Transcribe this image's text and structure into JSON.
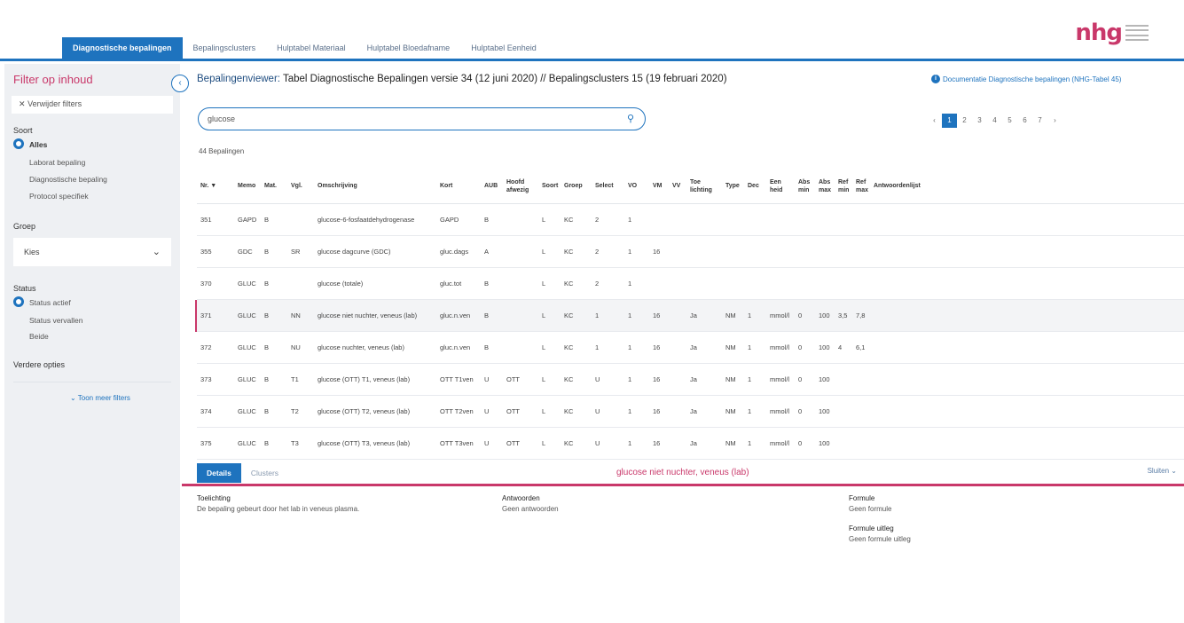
{
  "logo": {
    "text": "nhg"
  },
  "tabs": [
    {
      "label": "Diagnostische bepalingen"
    },
    {
      "label": "Bepalingsclusters"
    },
    {
      "label": "Hulptabel Materiaal"
    },
    {
      "label": "Hulptabel Bloedafname"
    },
    {
      "label": "Hulptabel Eenheid"
    }
  ],
  "sidebar": {
    "title": "Filter op inhoud",
    "clear_filters": "Verwijder filters",
    "soort_label": "Soort",
    "soort_options": [
      "Alles",
      "Laborat bepaling",
      "Diagnostische bepaling",
      "Protocol specifiek"
    ],
    "groep_label": "Groep",
    "groep_value": "Kies",
    "status_label": "Status",
    "status_options": [
      "Status actief",
      "Status vervallen",
      "Beide"
    ],
    "meer_label": "Verdere opties",
    "more_filters": "Toon meer filters"
  },
  "main": {
    "title_prefix": "Bepalingenviewer:",
    "title_rest": "Tabel Diagnostische Bepalingen versie 34 (12 juni 2020) // Bepalingsclusters 15 (19 februari 2020)",
    "doc_link": "Documentatie Diagnostische bepalingen (NHG-Tabel 45)",
    "search_value": "glucose",
    "result_count": "44 Bepalingen",
    "pages": [
      "‹",
      "1",
      "2",
      "3",
      "4",
      "5",
      "6",
      "7",
      "›"
    ]
  },
  "table": {
    "headers": [
      "Nr. ▼",
      "Memo",
      "Mat.",
      "Vgl.",
      "Omschrijving",
      "Kort",
      "AUB",
      "Hoofd afwezig",
      "Soort",
      "Groep",
      "Select",
      "VO",
      "VM",
      "VV",
      "Toe lichting",
      "Type",
      "Dec",
      "Een heid",
      "Abs min",
      "Abs max",
      "Ref min",
      "Ref max",
      "Antwoordenlijst"
    ],
    "rows": [
      [
        "351",
        "GAPD",
        "B",
        "",
        "glucose-6-fosfaatdehydrogenase",
        "GAPD",
        "B",
        "",
        "L",
        "KC",
        "2",
        "1",
        "",
        "",
        "",
        "",
        "",
        "",
        "",
        "",
        "",
        "",
        ""
      ],
      [
        "355",
        "GDC",
        "B",
        "SR",
        "glucose dagcurve (GDC)",
        "gluc.dags",
        "A",
        "",
        "L",
        "KC",
        "2",
        "1",
        "16",
        "",
        "",
        "",
        "",
        "",
        "",
        "",
        "",
        "",
        ""
      ],
      [
        "370",
        "GLUC",
        "B",
        "",
        "glucose (totale)",
        "gluc.tot",
        "B",
        "",
        "L",
        "KC",
        "2",
        "1",
        "",
        "",
        "",
        "",
        "",
        "",
        "",
        "",
        "",
        "",
        ""
      ],
      [
        "371",
        "GLUC",
        "B",
        "NN",
        "glucose niet nuchter, veneus (lab)",
        "gluc.n.ven",
        "B",
        "",
        "L",
        "KC",
        "1",
        "1",
        "16",
        "",
        "Ja",
        "NM",
        "1",
        "mmol/l",
        "0",
        "100",
        "3,5",
        "7,8",
        ""
      ],
      [
        "372",
        "GLUC",
        "B",
        "NU",
        "glucose nuchter, veneus (lab)",
        "gluc.n.ven",
        "B",
        "",
        "L",
        "KC",
        "1",
        "1",
        "16",
        "",
        "Ja",
        "NM",
        "1",
        "mmol/l",
        "0",
        "100",
        "4",
        "6,1",
        ""
      ],
      [
        "373",
        "GLUC",
        "B",
        "T1",
        "glucose (OTT) T1, veneus (lab)",
        "OTT T1ven",
        "U",
        "OTT",
        "L",
        "KC",
        "U",
        "1",
        "16",
        "",
        "Ja",
        "NM",
        "1",
        "mmol/l",
        "0",
        "100",
        "",
        "",
        ""
      ],
      [
        "374",
        "GLUC",
        "B",
        "T2",
        "glucose (OTT) T2, veneus (lab)",
        "OTT T2ven",
        "U",
        "OTT",
        "L",
        "KC",
        "U",
        "1",
        "16",
        "",
        "Ja",
        "NM",
        "1",
        "mmol/l",
        "0",
        "100",
        "",
        "",
        ""
      ],
      [
        "375",
        "GLUC",
        "B",
        "T3",
        "glucose (OTT) T3, veneus (lab)",
        "OTT T3ven",
        "U",
        "OTT",
        "L",
        "KC",
        "U",
        "1",
        "16",
        "",
        "Ja",
        "NM",
        "1",
        "mmol/l",
        "0",
        "100",
        "",
        "",
        ""
      ]
    ]
  },
  "detail": {
    "tabs": [
      "Details",
      "Clusters"
    ],
    "title": "glucose niet nuchter, veneus (lab)",
    "close": "Sluiten",
    "toelichting_label": "Toelichting",
    "toelichting_value": "De bepaling gebeurt door het lab in veneus plasma.",
    "antwoorden_label": "Antwoorden",
    "antwoorden_value": "Geen antwoorden",
    "formule_label": "Formule",
    "formule_value": "Geen formule",
    "formule_uitleg_label": "Formule uitleg",
    "formule_uitleg_value": "Geen formule uitleg"
  },
  "colors": {
    "accent": "#1e73be",
    "brand": "#c9386a"
  }
}
